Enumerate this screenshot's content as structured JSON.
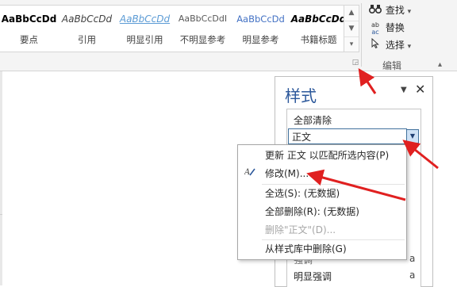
{
  "gallery": {
    "styles": [
      {
        "preview": "AaBbCcDd",
        "name": "要点",
        "preview_color": "#000000",
        "italic": false,
        "bold": true,
        "underline": false
      },
      {
        "preview": "AaBbCcDd",
        "name": "引用",
        "preview_color": "#404040",
        "italic": true,
        "bold": false,
        "underline": false
      },
      {
        "preview": "AaBbCcDd",
        "name": "明显引用",
        "preview_color": "#5b9bd5",
        "italic": true,
        "bold": false,
        "underline": true
      },
      {
        "preview": "AaBbCcDdI",
        "name": "不明显参考",
        "preview_color": "#595959",
        "italic": false,
        "bold": false,
        "underline": false
      },
      {
        "preview": "AaBbCcDd",
        "name": "明显参考",
        "preview_color": "#4472c4",
        "italic": false,
        "bold": false,
        "underline": false
      },
      {
        "preview": "AaBbCcDd",
        "name": "书籍标题",
        "preview_color": "#000000",
        "italic": true,
        "bold": true,
        "underline": false
      }
    ],
    "scroll_up_icon": "chevron-up-icon",
    "scroll_down_icon": "chevron-down-icon",
    "more_icon": "more-icon",
    "launcher_icon": "dialog-launcher-icon"
  },
  "editing": {
    "find_label": "查找",
    "find_dropdown": "▾",
    "replace_label": "替换",
    "select_label": "选择",
    "select_dropdown": "▾",
    "group_label": "编辑",
    "collapse_icon": "chevron-up-icon"
  },
  "styles_pane": {
    "title": "样式",
    "menu_icon": "▼",
    "close_icon": "✕",
    "clear_all": "全部清除",
    "selected_style": "正文",
    "bottom_rows": [
      {
        "label": "强调",
        "mark": "a"
      },
      {
        "label": "明显强调",
        "mark": "a"
      }
    ]
  },
  "context_menu": {
    "items": [
      {
        "label": "更新 正文 以匹配所选内容(P)",
        "disabled": false,
        "icon": ""
      },
      {
        "label": "修改(M)...",
        "disabled": false,
        "icon": "modify-icon"
      },
      {
        "label": "全选(S): (无数据)",
        "disabled": false,
        "icon": ""
      },
      {
        "label": "全部删除(R): (无数据)",
        "disabled": false,
        "icon": ""
      },
      {
        "label": "删除\"正文\"(D)...",
        "disabled": true,
        "icon": ""
      },
      {
        "label": "从样式库中删除(G)",
        "disabled": false,
        "icon": ""
      }
    ]
  },
  "annotation": {
    "arrow_color": "#e02020"
  }
}
